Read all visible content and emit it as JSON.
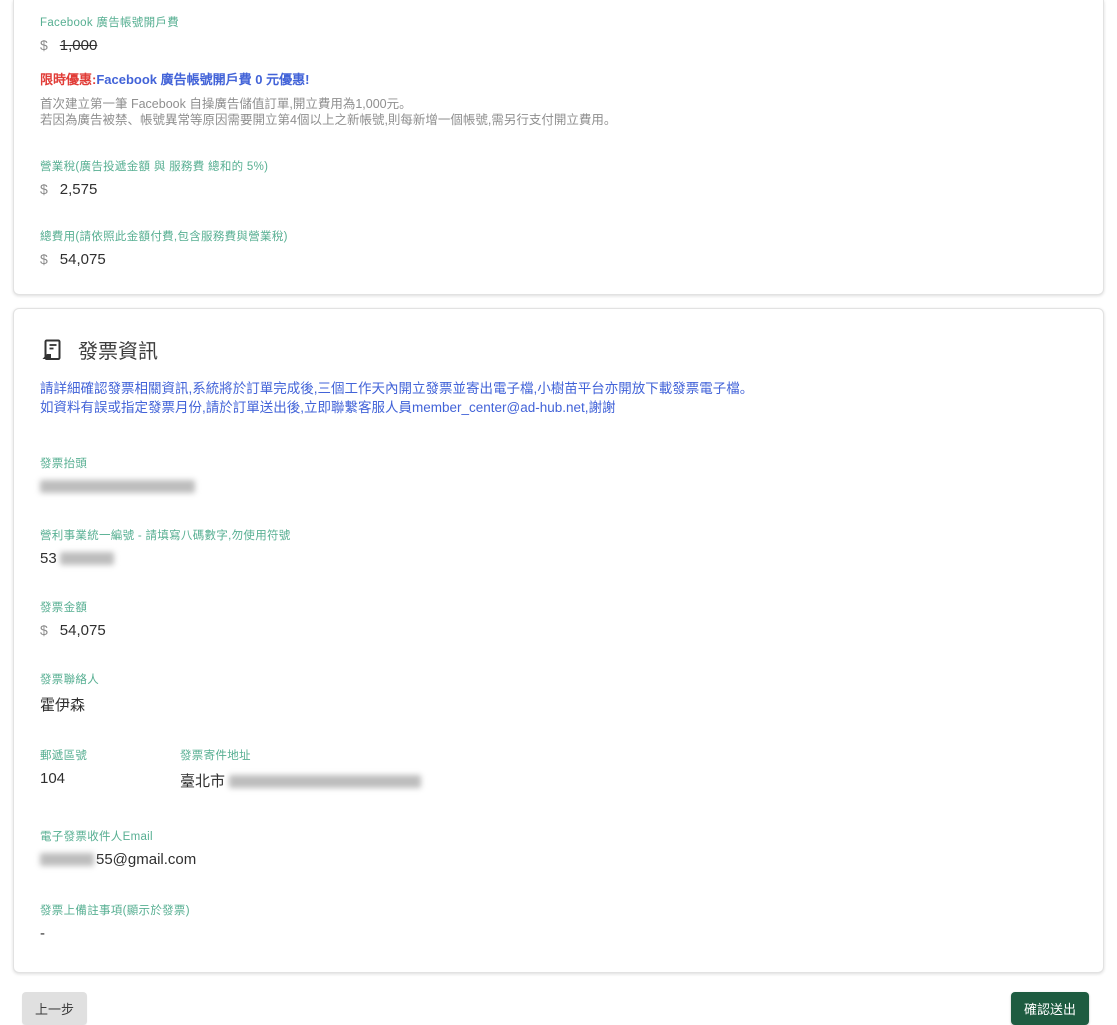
{
  "currency_symbol": "$",
  "fees_card": {
    "opening_fee_label": "Facebook 廣告帳號開戶費",
    "opening_fee_original": "1,000",
    "promo_prefix": "限時優惠:",
    "promo_text": "Facebook 廣告帳號開戶費 0 元優惠!",
    "note_line1": "首次建立第一筆 Facebook 自操廣告儲值訂單,開立費用為1,000元。",
    "note_line2": "若因為廣告被禁、帳號異常等原因需要開立第4個以上之新帳號,則每新增一個帳號,需另行支付開立費用。",
    "tax_label": "營業稅(廣告投遞金額 與 服務費 總和的 5%)",
    "tax_value": "2,575",
    "total_label": "總費用(請依照此金額付費,包含服務費與營業稅)",
    "total_value": "54,075"
  },
  "invoice_card": {
    "title": "發票資訊",
    "notice_line1": "請詳細確認發票相關資訊,系統將於訂單完成後,三個工作天內開立發票並寄出電子檔,小樹苗平台亦開放下載發票電子檔。",
    "notice_line2": "如資料有誤或指定發票月份,請於訂單送出後,立即聯繫客服人員member_center@ad-hub.net,謝謝",
    "invoice_title_label": "發票抬頭",
    "tax_id_label": "營利事業統一編號 - 請填寫八碼數字,勿使用符號",
    "tax_id_visible": "53",
    "amount_label": "發票金額",
    "amount_value": "54,075",
    "contact_label": "發票聯絡人",
    "contact_value": "霍伊森",
    "postal_label": "郵遞區號",
    "postal_value": "104",
    "address_label": "發票寄件地址",
    "address_visible": "臺北市",
    "email_label": "電子發票收件人Email",
    "email_visible": "55@gmail.com",
    "remark_label": "發票上備註事項(顯示於發票)",
    "remark_value": "-"
  },
  "footer": {
    "back_label": "上一步",
    "submit_label": "確認送出"
  },
  "colors": {
    "label_green": "#57af92",
    "link_blue": "#4263d8",
    "promo_red": "#e13c37",
    "submit_green": "#1e5c41"
  }
}
